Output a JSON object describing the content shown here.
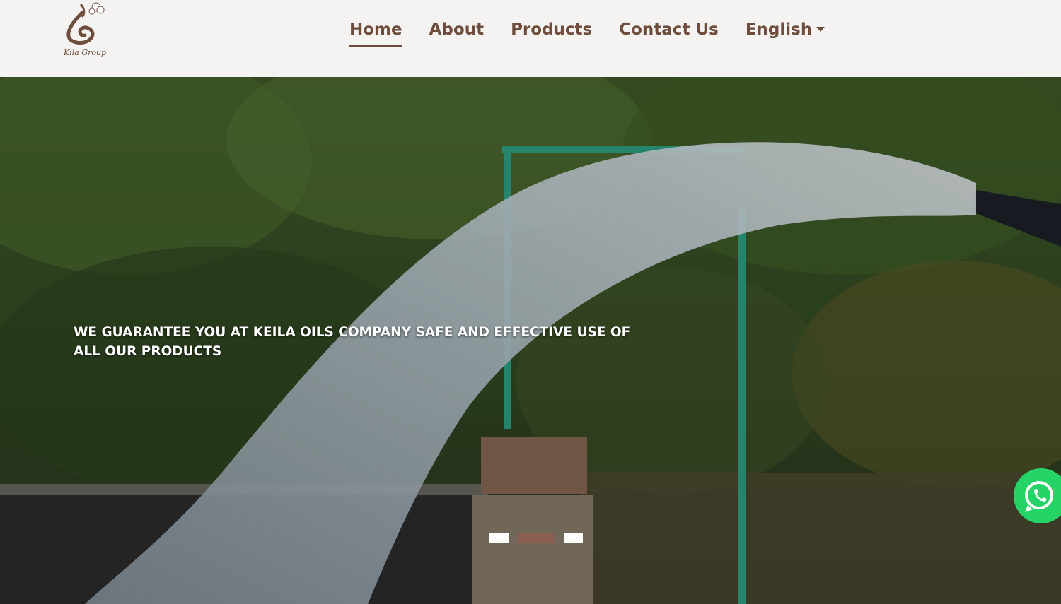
{
  "brand": {
    "logo_text": "Kila Group",
    "color": "#6f4d3c"
  },
  "nav": {
    "items": [
      {
        "label": "Home",
        "active": true
      },
      {
        "label": "About",
        "active": false
      },
      {
        "label": "Products",
        "active": false
      },
      {
        "label": "Contact Us",
        "active": false
      }
    ],
    "language": {
      "label": "English"
    }
  },
  "hero": {
    "caption": "WE GUARANTEE YOU AT KEILA OILS COMPANY SAFE AND EFFECTIVE USE OF ALL OUR PRODUCTS",
    "slides": [
      {
        "active": false
      },
      {
        "active": true
      },
      {
        "active": false
      }
    ],
    "indicator_colors": {
      "default": "#ffffff",
      "active": "#8a5e50"
    }
  },
  "whatsapp": {
    "icon": "whatsapp-icon",
    "color": "#25d366"
  }
}
